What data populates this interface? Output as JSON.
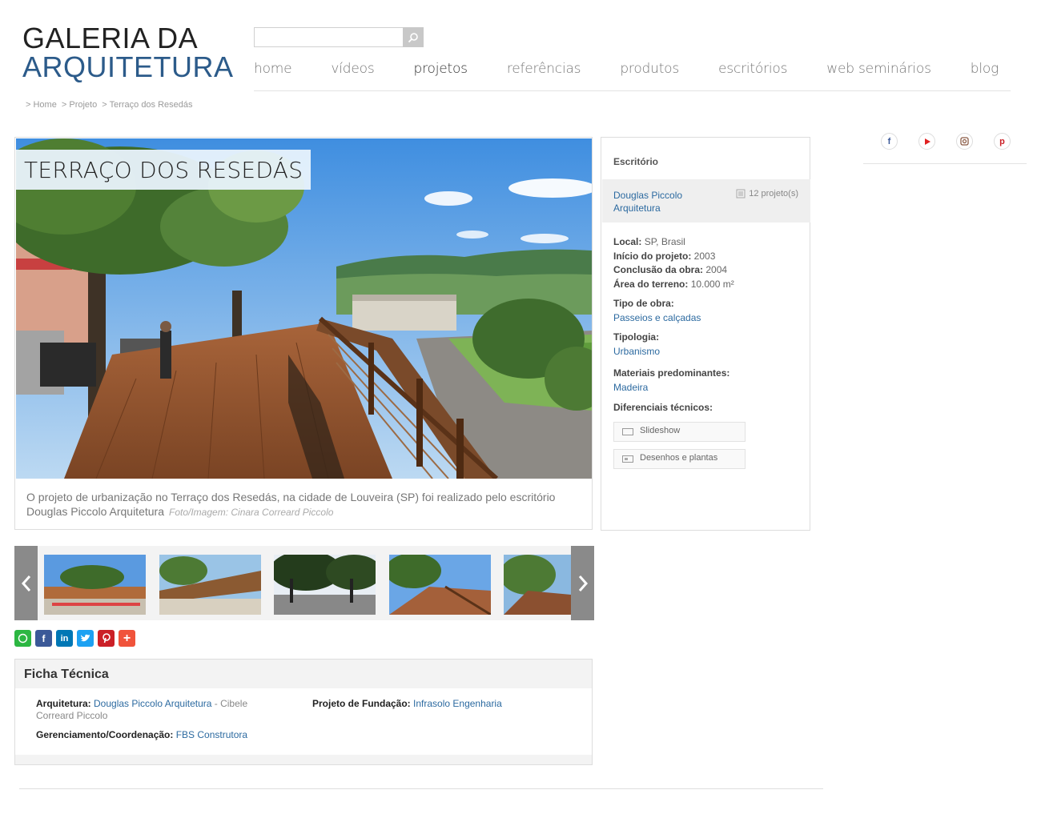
{
  "header": {
    "logo_line1": "GALERIA DA",
    "logo_line2": "ARQUITETURA",
    "search_placeholder": "",
    "nav": [
      {
        "label": "home",
        "active": false
      },
      {
        "label": "vídeos",
        "active": false
      },
      {
        "label": "projetos",
        "active": true
      },
      {
        "label": "referências",
        "active": false
      },
      {
        "label": "produtos",
        "active": false
      },
      {
        "label": "escritórios",
        "active": false
      },
      {
        "label": "web seminários",
        "active": false
      },
      {
        "label": "blog",
        "active": false
      }
    ]
  },
  "breadcrumb": {
    "items": [
      "> Home",
      "> Projeto",
      "> Terraço dos Resedás"
    ]
  },
  "project": {
    "title": "TERRAÇO DOS RESEDÁS",
    "caption": "O projeto de urbanização no Terraço dos Resedás, na cidade de Louveira (SP) foi realizado pelo escritório Douglas Piccolo Arquitetura",
    "credit": "Foto/Imagem:  Cinara Correard Piccolo"
  },
  "info": {
    "office_label": "Escritório",
    "office_name": "Douglas Piccolo Arquitetura",
    "office_count": "12 projeto(s)",
    "local_label": "Local:",
    "local_value": "SP, Brasil",
    "inicio_label": "Início do projeto:",
    "inicio_value": "2003",
    "conclusao_label": "Conclusão da obra:",
    "conclusao_value": "2004",
    "area_label": "Área do terreno:",
    "area_value": "10.000 m²",
    "tipo_label": "Tipo de obra:",
    "tipo_value": "Passeios e calçadas",
    "tipologia_label": "Tipologia:",
    "tipologia_value": "Urbanismo",
    "materiais_label": "Materiais predominantes:",
    "materiais_value": "Madeira",
    "diferenciais_label": "Diferenciais técnicos:",
    "btn_slideshow": "Slideshow",
    "btn_desenhos": "Desenhos e plantas"
  },
  "social": [
    "facebook-icon",
    "youtube-icon",
    "instagram-icon",
    "pinterest-icon"
  ],
  "share": [
    {
      "name": "whatsapp-icon",
      "color": "#2cb742"
    },
    {
      "name": "facebook-icon",
      "color": "#3b5998"
    },
    {
      "name": "linkedin-icon",
      "color": "#0077b5"
    },
    {
      "name": "twitter-icon",
      "color": "#1da1f2"
    },
    {
      "name": "pinterest-icon",
      "color": "#cb2027"
    },
    {
      "name": "plus-icon",
      "color": "#f0533b"
    }
  ],
  "ficha": {
    "title": "Ficha Técnica",
    "arq_label": "Arquitetura:",
    "arq_link": "Douglas Piccolo Arquitetura",
    "arq_rest": " - Cibele Correard Piccolo",
    "fund_label": "Projeto de Fundação:",
    "fund_link": "Infrasolo Engenharia",
    "ger_label": "Gerenciamento/Coordenação:",
    "ger_link": "FBS Construtora"
  },
  "colors": {
    "brand_blue": "#2c5b8a",
    "link_blue": "#2c6aa0"
  }
}
